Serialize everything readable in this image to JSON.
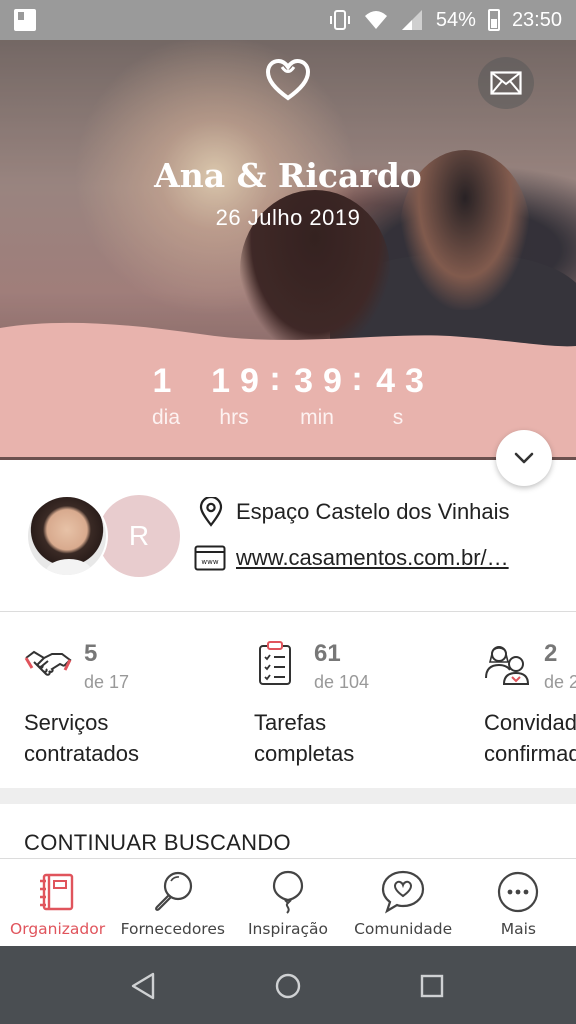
{
  "status_bar": {
    "battery": "54%",
    "time": "23:50"
  },
  "hero": {
    "names": "Ana & Ricardo",
    "date": "26 Julho 2019"
  },
  "countdown": {
    "days": "1",
    "days_label": "dia",
    "hours": "19",
    "hours_label": "hrs",
    "minutes": "39",
    "minutes_label": "min",
    "seconds": "43",
    "seconds_label": "s",
    "separator": ":"
  },
  "info": {
    "partner_initial": "R",
    "venue": "Espaço Castelo dos Vinhais",
    "website": "www.casamentos.com.br/…"
  },
  "stats": [
    {
      "count": "5",
      "total": "de 17",
      "label": "Serviços\ncontratados",
      "icon": "handshake-icon"
    },
    {
      "count": "61",
      "total": "de 104",
      "label": "Tarefas\ncompletas",
      "icon": "checklist-icon"
    },
    {
      "count": "2",
      "total": "de 2",
      "label": "Convidados\nconfirmados",
      "icon": "guests-icon"
    }
  ],
  "section": {
    "continue_title": "CONTINUAR BUSCANDO"
  },
  "bottom_nav": [
    {
      "label": "Organizador",
      "icon": "planner-icon",
      "active": true
    },
    {
      "label": "Fornecedores",
      "icon": "magnifier-icon",
      "active": false
    },
    {
      "label": "Inspiração",
      "icon": "balloon-icon",
      "active": false
    },
    {
      "label": "Comunidade",
      "icon": "chat-heart-icon",
      "active": false
    },
    {
      "label": "Mais",
      "icon": "more-icon",
      "active": false
    }
  ],
  "colors": {
    "accent": "#e0545c",
    "band": "#e8b3ad",
    "avatar_bg": "#e8ccce"
  }
}
